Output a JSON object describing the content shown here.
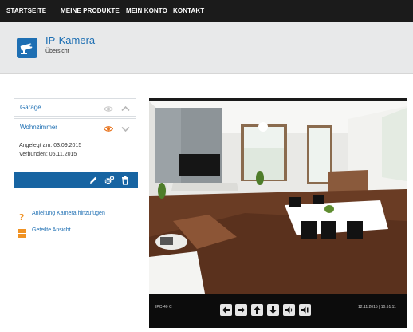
{
  "nav": {
    "items": [
      "STARTSEITE",
      "MEINE PRODUKTE",
      "MEIN KONTO",
      "KONTAKT"
    ]
  },
  "header": {
    "title": "IP-Kamera",
    "subtitle": "Übersicht"
  },
  "cameras": [
    {
      "name": "Garage",
      "visible": false,
      "expanded": false
    },
    {
      "name": "Wohnzimmer",
      "visible": true,
      "expanded": true
    }
  ],
  "details": {
    "created": "Angelegt am: 03.09.2015",
    "connected": "Verbunden: 05.11.2015"
  },
  "actions": {
    "icons": [
      "pencil-icon",
      "settings-gears-icon",
      "trash-icon"
    ]
  },
  "links": [
    {
      "label": "Anleitung Kamera hinzufügen",
      "icon": "question-icon"
    },
    {
      "label": "Geteilte Ansicht",
      "icon": "grid-view-icon"
    }
  ],
  "viewer": {
    "camera_label": "IPC-40 C",
    "timestamp": "12.11.2015 | 10:51:11",
    "controls": [
      "arrow-left-icon",
      "arrow-right-icon",
      "arrow-up-icon",
      "arrow-down-icon",
      "speaker-icon",
      "speaker-muted-icon"
    ]
  },
  "colors": {
    "accent": "#1e6fb3",
    "nav_bg": "#1b1b1b",
    "header_bg": "#e8e9ea",
    "eye_active": "#e8731c",
    "orange": "#f09223"
  }
}
